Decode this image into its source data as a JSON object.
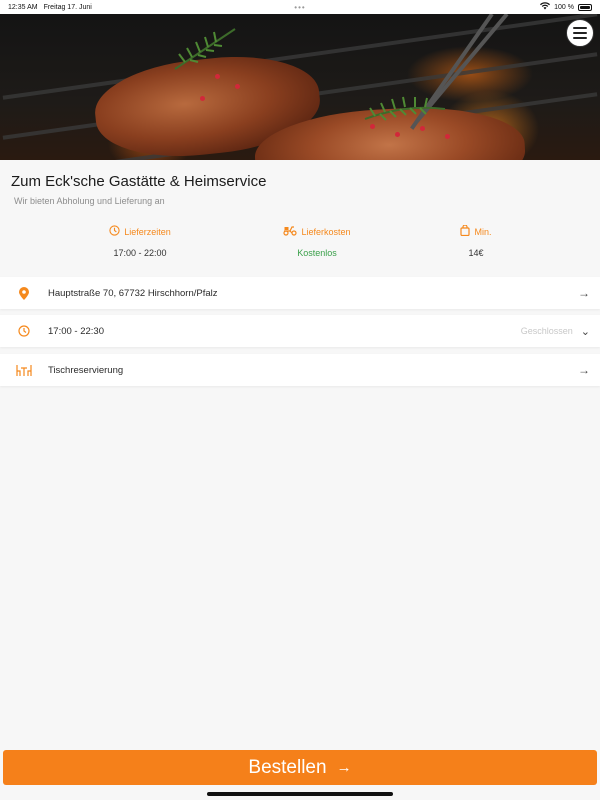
{
  "status": {
    "time": "12:35 AM",
    "date": "Freitag 17. Juni",
    "battery": "100 %"
  },
  "header": {
    "menu_icon": "hamburger-menu-icon"
  },
  "restaurant": {
    "name": "Zum Eck'sche Gastätte & Heimservice",
    "tagline": "Wir bieten Abholung und Lieferung an"
  },
  "info": {
    "delivery_times": {
      "label": "Lieferzeiten",
      "value": "17:00 - 22:00",
      "icon": "clock-icon"
    },
    "delivery_costs": {
      "label": "Lieferkosten",
      "value": "Kostenlos",
      "icon": "scooter-icon"
    },
    "minimum": {
      "label": "Min.",
      "value": "14€",
      "icon": "bag-icon"
    }
  },
  "cards": {
    "address": {
      "text": "Hauptstraße 70, 67732 Hirschhorn/Pfalz",
      "icon": "location-pin-icon",
      "arrow": "→"
    },
    "hours": {
      "text": "17:00 - 22:30",
      "status": "Geschlossen",
      "icon": "clock-icon",
      "chevron": "⌄"
    },
    "reservation": {
      "text": "Tischreservierung",
      "icon": "table-icon",
      "arrow": "→"
    }
  },
  "order": {
    "label": "Bestellen",
    "arrow": "→"
  },
  "colors": {
    "accent": "#f5801a",
    "green": "#3aa04a",
    "muted": "#8d8d8d"
  }
}
